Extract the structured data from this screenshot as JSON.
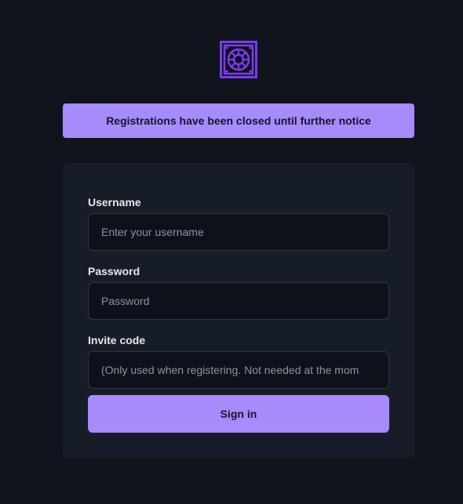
{
  "logo": {
    "icon": "vault-icon",
    "color": "#7c3aed"
  },
  "banner": {
    "text": "Registrations have been closed until further notice"
  },
  "form": {
    "username": {
      "label": "Username",
      "placeholder": "Enter your username",
      "value": ""
    },
    "password": {
      "label": "Password",
      "placeholder": "Password",
      "value": ""
    },
    "invite_code": {
      "label": "Invite code",
      "placeholder": "(Only used when registering. Not needed at the mom",
      "value": ""
    },
    "submit_label": "Sign in"
  },
  "colors": {
    "background": "#0f141d",
    "card": "#171d28",
    "accent": "#a78bfa",
    "input_bg": "#0d121a",
    "input_border": "#2f3744"
  }
}
